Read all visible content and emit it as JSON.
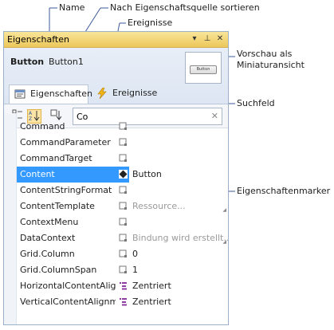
{
  "callouts": {
    "name": "Name",
    "sort": "Nach Eigenschaftsquelle sortieren",
    "events": "Ereignisse",
    "preview": "Vorschau als Miniaturansicht",
    "search": "Suchfeld",
    "marker": "Eigenschaftenmarker"
  },
  "panel": {
    "title": "Eigenschaften",
    "title_buttons": [
      "▾",
      "⊥",
      "✕"
    ],
    "object_type": "Button",
    "object_name": "Button1",
    "thumbnail_label": "Button",
    "tabs": [
      {
        "label": "Eigenschaften",
        "icon": "properties-icon"
      },
      {
        "label": "Ereignisse",
        "icon": "lightning-icon"
      }
    ],
    "search_value": "Co"
  },
  "properties": [
    {
      "name": "Command",
      "value": ""
    },
    {
      "name": "CommandParameter",
      "value": ""
    },
    {
      "name": "CommandTarget",
      "value": ""
    },
    {
      "name": "Content",
      "value": "Button"
    },
    {
      "name": "ContentStringFormat",
      "value": ""
    },
    {
      "name": "ContentTemplate",
      "value": "Ressource..."
    },
    {
      "name": "ContextMenu",
      "value": ""
    },
    {
      "name": "DataContext",
      "value": "Bindung wird erstellt..."
    },
    {
      "name": "Grid.Column",
      "value": "0"
    },
    {
      "name": "Grid.ColumnSpan",
      "value": "1"
    },
    {
      "name": "HorizontalContentAlig...",
      "value": "Zentriert"
    },
    {
      "name": "VerticalContentAlignm...",
      "value": "Zentriert"
    }
  ],
  "colors": {
    "titlebar": "#ecc85a",
    "selection": "#3399ff",
    "header": "#dde6f2"
  }
}
